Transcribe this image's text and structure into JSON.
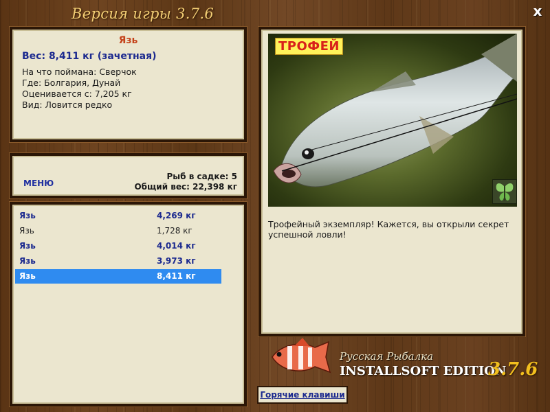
{
  "window": {
    "title": "Версия игры 3.7.6",
    "close_label": "x"
  },
  "info": {
    "fish_name": "Язь",
    "weight_line": "Вес: 8,411 кг (зачетная)",
    "caught_on": "На что поймана: Сверчок",
    "location": "Где: Болгария, Дунай",
    "rated_from": "Оценивается с: 7,205 кг",
    "rarity": "Вид: Ловится редко"
  },
  "menu": {
    "menu_label": "МЕНЮ",
    "fish_in_cage": "Рыб в садке: 5",
    "total_weight": "Общий вес: 22,398 кг"
  },
  "catches": [
    {
      "name": "Язь",
      "weight": "4,269 кг",
      "style": "bold"
    },
    {
      "name": "Язь",
      "weight": "1,728 кг",
      "style": "normal"
    },
    {
      "name": "Язь",
      "weight": "4,014 кг",
      "style": "bold"
    },
    {
      "name": "Язь",
      "weight": "3,973 кг",
      "style": "bold"
    },
    {
      "name": "Язь",
      "weight": "8,411 кг",
      "style": "selected"
    }
  ],
  "trophy": {
    "badge": "ТРОФЕЙ",
    "message": "Трофейный экземпляр! Кажется, вы открыли секрет успешной ловли!"
  },
  "logo": {
    "title": "Русская Рыбалка",
    "edition": "INSTALLSOFT EDITION",
    "version": "3.7.6"
  },
  "hotkeys_label": "Горячие клавиши",
  "icons": {
    "close": "close-icon",
    "butterfly": "butterfly-icon",
    "logo_fish": "fish-logo-icon"
  },
  "colors": {
    "accent_blue": "#1c2a8f",
    "name_red": "#c4421a",
    "selection": "#2f8bf0",
    "version_gold": "#f2bf1e"
  }
}
